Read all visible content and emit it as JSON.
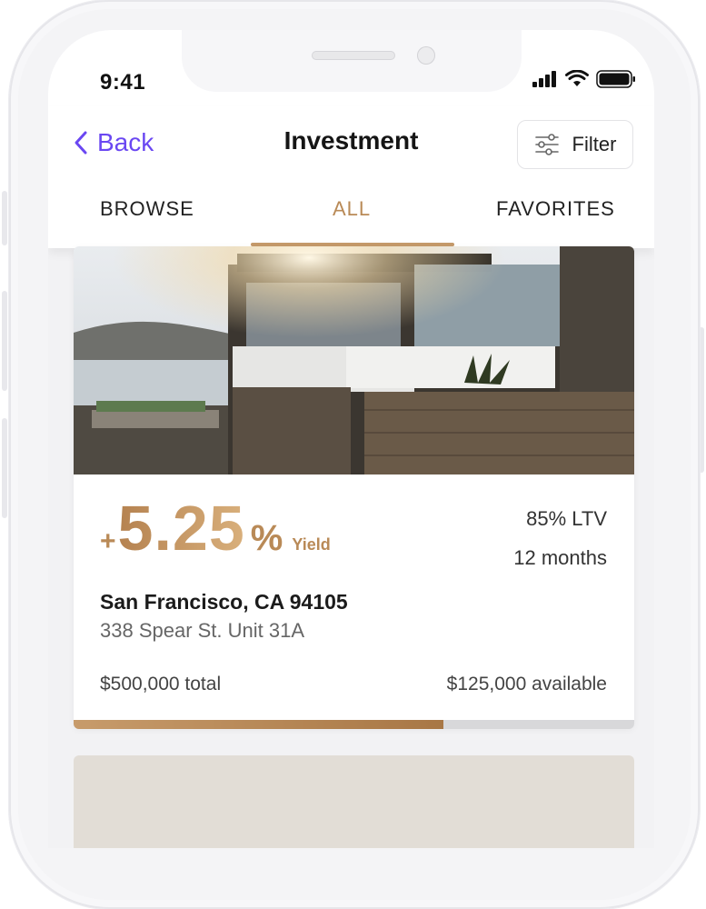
{
  "status_bar": {
    "time": "9:41",
    "icons": [
      "signal-icon",
      "wifi-icon",
      "battery-icon"
    ]
  },
  "nav": {
    "back_label": "Back",
    "title": "Investment",
    "filter_label": "Filter"
  },
  "tabs": [
    {
      "label": "BROWSE",
      "active": false
    },
    {
      "label": "ALL",
      "active": true
    },
    {
      "label": "FAVORITES",
      "active": false
    }
  ],
  "listing": {
    "yield_sign": "+",
    "yield_value": "5.25",
    "yield_unit": "%",
    "yield_label": "Yield",
    "ltv": "85% LTV",
    "term": "12 months",
    "city": "San Francisco, CA 94105",
    "address": "338 Spear St. Unit 31A",
    "total": "$500,000 total",
    "available": "$125,000 available",
    "funded_fraction": 0.66
  },
  "colors": {
    "accent": "#6a47f2",
    "gold": "#b98a57"
  }
}
